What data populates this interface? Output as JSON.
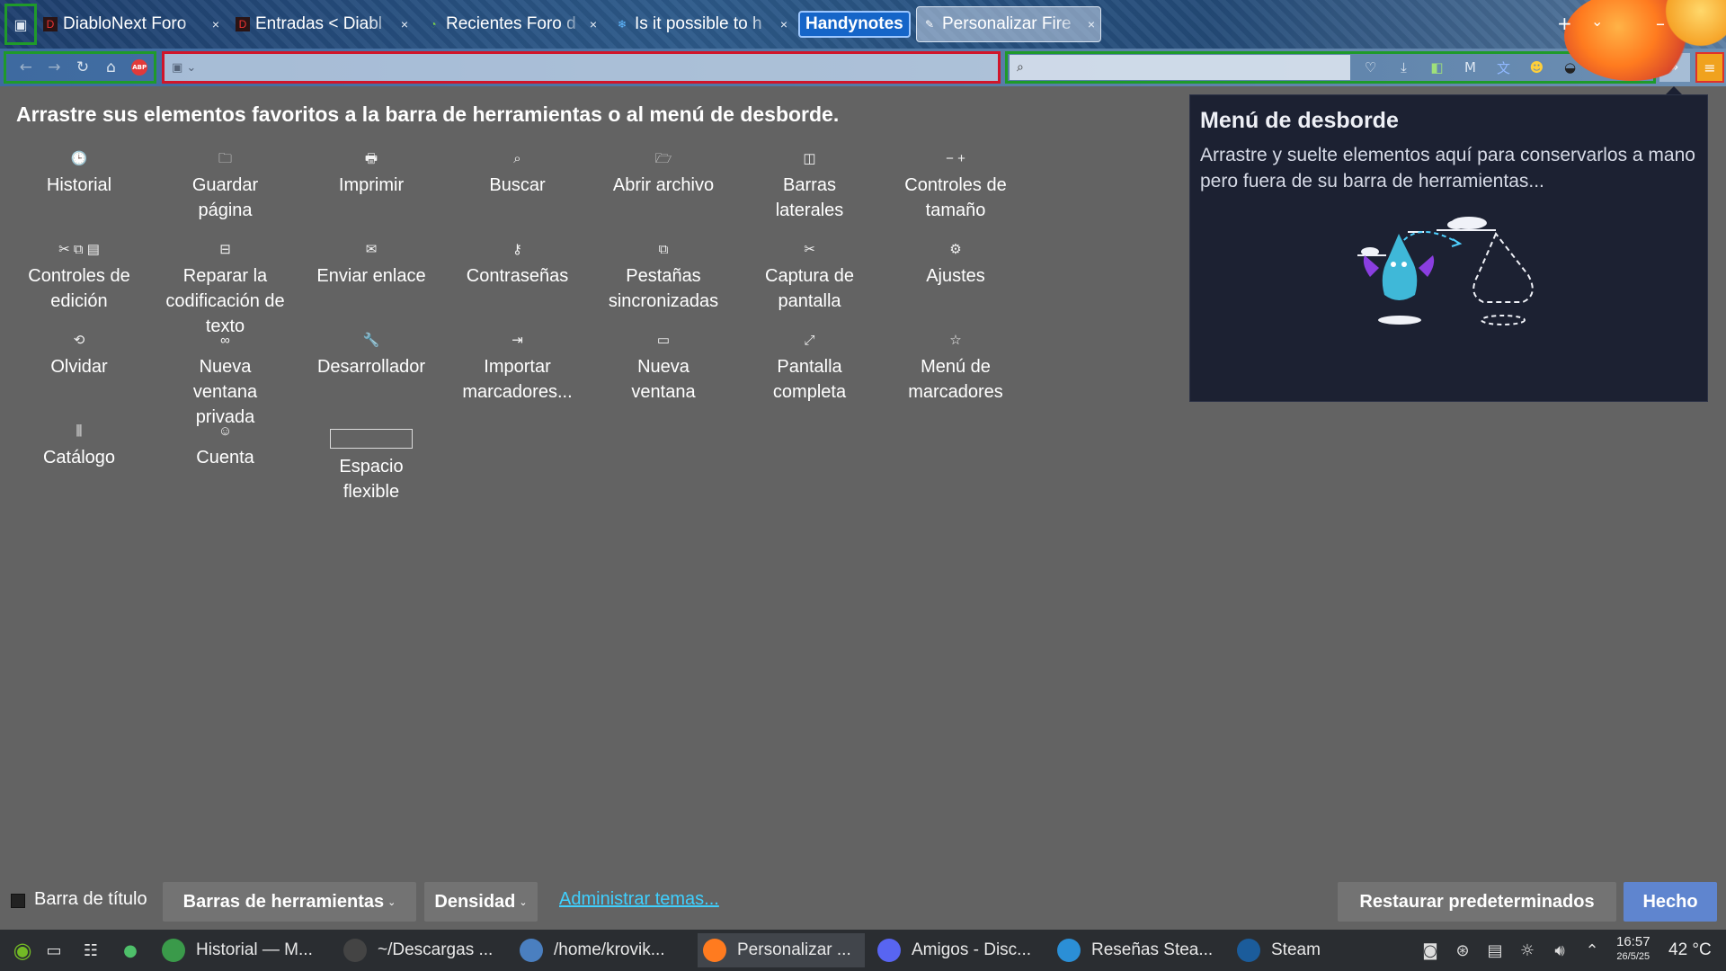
{
  "tabs": [
    {
      "title": "DiabloNext Foro",
      "favicon": "diablo-favicon"
    },
    {
      "title": "Entradas < Diabl",
      "favicon": "diablo-favicon"
    },
    {
      "title": "Recientes Foro d",
      "favicon": "green-swirl-favicon"
    },
    {
      "title": "Is it possible to h",
      "favicon": "snowflake-favicon"
    },
    {
      "title": "Handynotes",
      "favicon": ""
    },
    {
      "title": "Personalizar Fire",
      "favicon": "customize-favicon"
    }
  ],
  "tabs_close_glyph": "×",
  "new_tab_glyph": "+",
  "heading": "Arrastre sus elementos favoritos a la barra de herramientas o al menú de desborde.",
  "palette": [
    {
      "icon": "history-icon",
      "glyph": "🕒",
      "label_lines": [
        "Historial"
      ]
    },
    {
      "icon": "save-page-icon",
      "glyph": "🗀",
      "label_lines": [
        "Guardar",
        "página"
      ]
    },
    {
      "icon": "print-icon",
      "glyph": "🖶",
      "label_lines": [
        "Imprimir"
      ]
    },
    {
      "icon": "search-icon",
      "glyph": "⌕",
      "label_lines": [
        "Buscar"
      ]
    },
    {
      "icon": "open-file-icon",
      "glyph": "🗁",
      "label_lines": [
        "Abrir archivo"
      ]
    },
    {
      "icon": "sidebar-icon",
      "glyph": "◫",
      "label_lines": [
        "Barras",
        "laterales"
      ]
    },
    {
      "icon": "zoom-controls-icon",
      "glyph": "− +",
      "label_lines": [
        "Controles de",
        "tamaño"
      ]
    },
    {
      "icon": "edit-controls-icon",
      "glyph": "✂ ⧉ ▤",
      "label_lines": [
        "Controles de",
        "edición"
      ]
    },
    {
      "icon": "text-encoding-icon",
      "glyph": "⊟",
      "label_lines": [
        "Reparar la",
        "codificación de",
        "texto"
      ]
    },
    {
      "icon": "email-link-icon",
      "glyph": "✉",
      "label_lines": [
        "Enviar enlace"
      ]
    },
    {
      "icon": "passwords-icon",
      "glyph": "⚷",
      "label_lines": [
        "Contraseñas"
      ]
    },
    {
      "icon": "synced-tabs-icon",
      "glyph": "⧉",
      "label_lines": [
        "Pestañas",
        "sincronizadas"
      ]
    },
    {
      "icon": "screenshot-icon",
      "glyph": "✂",
      "label_lines": [
        "Captura de",
        "pantalla"
      ]
    },
    {
      "icon": "settings-icon",
      "glyph": "⚙",
      "label_lines": [
        "Ajustes"
      ]
    },
    {
      "icon": "forget-icon",
      "glyph": "⟲",
      "label_lines": [
        "Olvidar"
      ]
    },
    {
      "icon": "private-window-icon",
      "glyph": "∞",
      "label_lines": [
        "Nueva",
        "ventana",
        "privada"
      ]
    },
    {
      "icon": "developer-icon",
      "glyph": "🔧",
      "label_lines": [
        "Desarrollador"
      ]
    },
    {
      "icon": "import-bookmarks-icon",
      "glyph": "⇥",
      "label_lines": [
        "Importar",
        "marcadores..."
      ]
    },
    {
      "icon": "new-window-icon",
      "glyph": "▭",
      "label_lines": [
        "Nueva",
        "ventana"
      ]
    },
    {
      "icon": "fullscreen-icon",
      "glyph": "⤢",
      "label_lines": [
        "Pantalla",
        "completa"
      ]
    },
    {
      "icon": "bookmarks-menu-icon",
      "glyph": "☆",
      "label_lines": [
        "Menú de",
        "marcadores"
      ]
    },
    {
      "icon": "library-icon",
      "glyph": "⫼",
      "label_lines": [
        "Catálogo"
      ]
    },
    {
      "icon": "account-icon",
      "glyph": "☺",
      "label_lines": [
        "Cuenta"
      ]
    },
    {
      "icon": "flexible-space-icon",
      "glyph": "",
      "label_lines": [
        "Espacio",
        "flexible"
      ]
    }
  ],
  "overflow_panel": {
    "title": "Menú de desborde",
    "description": "Arrastre y suelte elementos aquí para conservarlos a mano pero fuera de su barra de herramientas..."
  },
  "footer": {
    "titlebar_label": "Barra de título",
    "toolbars_label": "Barras de herramientas",
    "density_label": "Densidad",
    "manage_themes_label": "Administrar temas...",
    "restore_label": "Restaurar predeterminados",
    "done_label": "Hecho"
  },
  "taskbar": {
    "tasks": [
      {
        "label": "Historial — M...",
        "icon": "system-monitor-icon",
        "color": "#3a9a4a"
      },
      {
        "label": "~/Descargas ...",
        "icon": "terminal-icon",
        "color": "#444"
      },
      {
        "label": "/home/krovik...",
        "icon": "folder-icon",
        "color": "#4a7fc0"
      },
      {
        "label": "Personalizar ...",
        "icon": "firefox-icon",
        "color": "#ff7b1f"
      },
      {
        "label": "Amigos - Disc...",
        "icon": "discord-icon",
        "color": "#5865f2"
      },
      {
        "label": "Reseñas Stea...",
        "icon": "steam-tinker-icon",
        "color": "#2b8fd6"
      },
      {
        "label": "Steam",
        "icon": "steam-icon",
        "color": "#1b5c9b"
      }
    ],
    "time": "16:57",
    "date": "26/5/25",
    "temperature": "42 °C"
  },
  "colors": {
    "highlight_green": "#1f9a2a",
    "highlight_red": "#d0152a",
    "link": "#3fd0ff",
    "done_button": "#5f85cf"
  }
}
